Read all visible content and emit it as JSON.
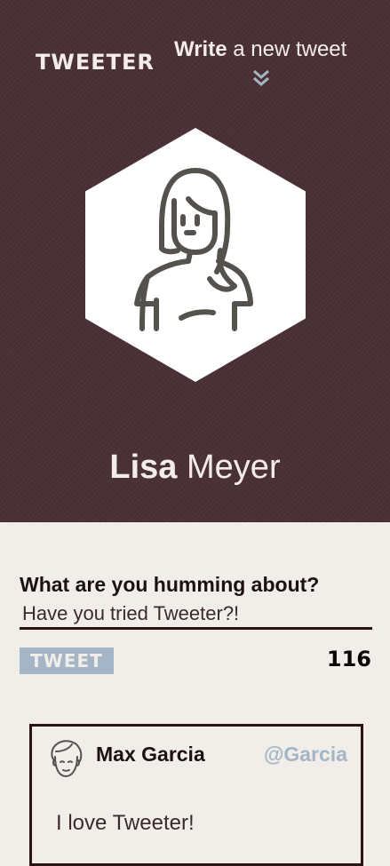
{
  "header": {
    "logo": "TWEETER",
    "write_link_bold": "Write",
    "write_link_rest": " a new tweet",
    "chevron_icon": "double-chevron-down-icon"
  },
  "profile": {
    "first_name": "Lisa",
    "last_name": "Meyer",
    "avatar_icon": "woman-avatar-icon"
  },
  "compose": {
    "label": "What are you humming about?",
    "input_value": "Have you tried Tweeter?!",
    "button_label": "TWEET",
    "char_count": "116"
  },
  "feed": {
    "tweets": [
      {
        "author": "Max Garcia",
        "handle": "@Garcia",
        "text": "I love Tweeter!",
        "avatar_icon": "man-avatar-icon"
      }
    ]
  },
  "colors": {
    "hero_bg": "#4a3034",
    "page_bg": "#f1eeea",
    "accent": "#a4b6c6",
    "dark": "#2a1416"
  }
}
